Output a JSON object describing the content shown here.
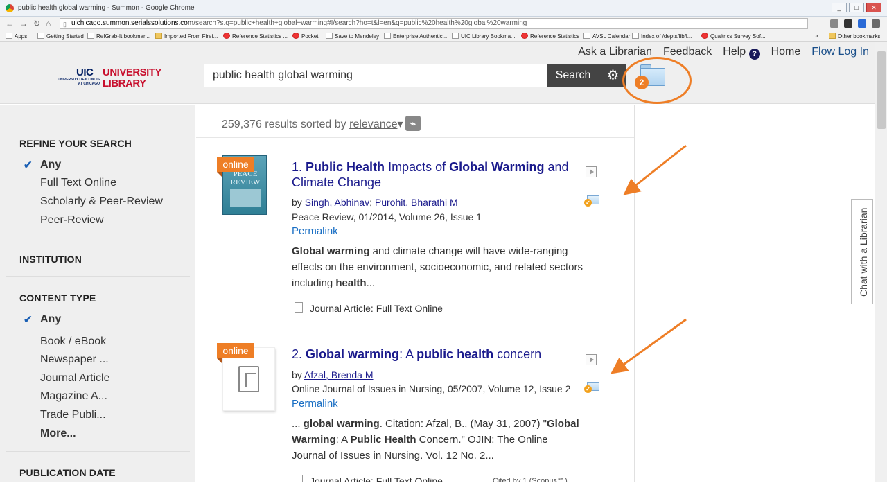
{
  "window": {
    "title": "public health global warming - Summon - Google Chrome",
    "url_host": "uichicago.summon.serialssolutions.com",
    "url_path": "/search?s.q=public+health+global+warming#!/search?ho=t&l=en&q=public%20health%20global%20warming",
    "btn_min": "_",
    "btn_max": "□",
    "btn_close": "✕"
  },
  "bookmarks": [
    {
      "label": "Apps",
      "kind": "apps"
    },
    {
      "label": "Getting Started",
      "kind": "page"
    },
    {
      "label": "RefGrab-It bookmar...",
      "kind": "page"
    },
    {
      "label": "Imported From Firef...",
      "kind": "folder"
    },
    {
      "label": "Reference Statistics ...",
      "kind": "red"
    },
    {
      "label": "Pocket",
      "kind": "red"
    },
    {
      "label": "Save to Mendeley",
      "kind": "page"
    },
    {
      "label": "Enterprise Authentic...",
      "kind": "page"
    },
    {
      "label": "UIC Library Bookma...",
      "kind": "page"
    },
    {
      "label": "Reference Statistics",
      "kind": "red"
    },
    {
      "label": "AVSL Calendar",
      "kind": "page"
    },
    {
      "label": "Index of /depts/lib/l...",
      "kind": "page"
    },
    {
      "label": "Qualtrics Survey Sof...",
      "kind": "red"
    },
    {
      "label": "»",
      "kind": "text"
    },
    {
      "label": "Other bookmarks",
      "kind": "folder"
    }
  ],
  "header": {
    "links": {
      "ask": "Ask a Librarian",
      "feedback": "Feedback",
      "help": "Help",
      "help_icon": "?",
      "home": "Home",
      "login": "Flow Log In"
    },
    "logo": {
      "uic": "UIC",
      "university": "UNIVERSITY",
      "library": "LIBRARY",
      "small": "UNIVERSITY OF ILLINOIS AT CHICAGO"
    },
    "search_value": "public health global warming",
    "search_button": "Search",
    "gear_icon": "⚙",
    "folder_badge": "2"
  },
  "sidebar": {
    "refine_heading": "REFINE YOUR SEARCH",
    "refine_items": [
      "Any",
      "Full Text Online",
      "Scholarly & Peer-Review",
      "Peer-Review"
    ],
    "institution_heading": "INSTITUTION",
    "content_heading": "CONTENT TYPE",
    "content_items": [
      "Any",
      "Book / eBook",
      "Newspaper ...",
      "Journal Article",
      "Magazine A...",
      "Trade Publi...",
      "More..."
    ],
    "pubdate_heading": "PUBLICATION DATE",
    "check_icon": "✔"
  },
  "results_bar": {
    "count_text": "259,376 results sorted by",
    "sort_value": "relevance",
    "sort_caret": "▾",
    "rss_icon": "⌁"
  },
  "results": [
    {
      "number": "1.",
      "tag": "online",
      "thumb_text": "PEACE REVIEW",
      "title_parts": [
        {
          "text": "Public Health",
          "bold": true
        },
        {
          "text": " Impacts of ",
          "bold": false
        },
        {
          "text": "Global Warming",
          "bold": true
        },
        {
          "text": " and Climate Change",
          "bold": false
        }
      ],
      "by_label": "by",
      "authors": [
        "Singh, Abhinav",
        "Purohit, Bharathi M"
      ],
      "source": "Peace Review, 01/2014, Volume 26, Issue 1",
      "permalink": "Permalink",
      "snippet_parts": [
        {
          "text": "Global warming",
          "bold": true
        },
        {
          "text": " and climate change will have wide-ranging effects on the environment, socioeconomic, and related sectors including ",
          "bold": false
        },
        {
          "text": "health",
          "bold": true
        },
        {
          "text": "...",
          "bold": false
        }
      ],
      "type_label": "Journal Article:",
      "type_link": "Full Text Online"
    },
    {
      "number": "2.",
      "tag": "online",
      "title_parts": [
        {
          "text": "Global warming",
          "bold": true
        },
        {
          "text": ": A ",
          "bold": false
        },
        {
          "text": "public health",
          "bold": true
        },
        {
          "text": " concern",
          "bold": false
        }
      ],
      "by_label": "by",
      "authors": [
        "Afzal, Brenda M"
      ],
      "source": "Online Journal of Issues in Nursing, 05/2007, Volume 12, Issue 2",
      "permalink": "Permalink",
      "snippet_parts": [
        {
          "text": "... ",
          "bold": false
        },
        {
          "text": "global warming",
          "bold": true
        },
        {
          "text": ". Citation: Afzal, B., (May 31, 2007) \"",
          "bold": false
        },
        {
          "text": "Global Warming",
          "bold": true
        },
        {
          "text": ": A ",
          "bold": false
        },
        {
          "text": "Public Health",
          "bold": true
        },
        {
          "text": " Concern.\" OJIN: The Online Journal of Issues in Nursing. Vol. 12 No. 2...",
          "bold": false
        }
      ],
      "type_label": "Journal Article:",
      "type_link": "Full Text Online",
      "cited": "Cited by 1 (Scopus℠)"
    }
  ],
  "chat_tab": "Chat with a Librarian",
  "colors": {
    "accent_orange": "#ee7e26",
    "title_blue": "#1a1a8c",
    "uic_navy": "#001e62",
    "uic_red": "#c8102e"
  }
}
